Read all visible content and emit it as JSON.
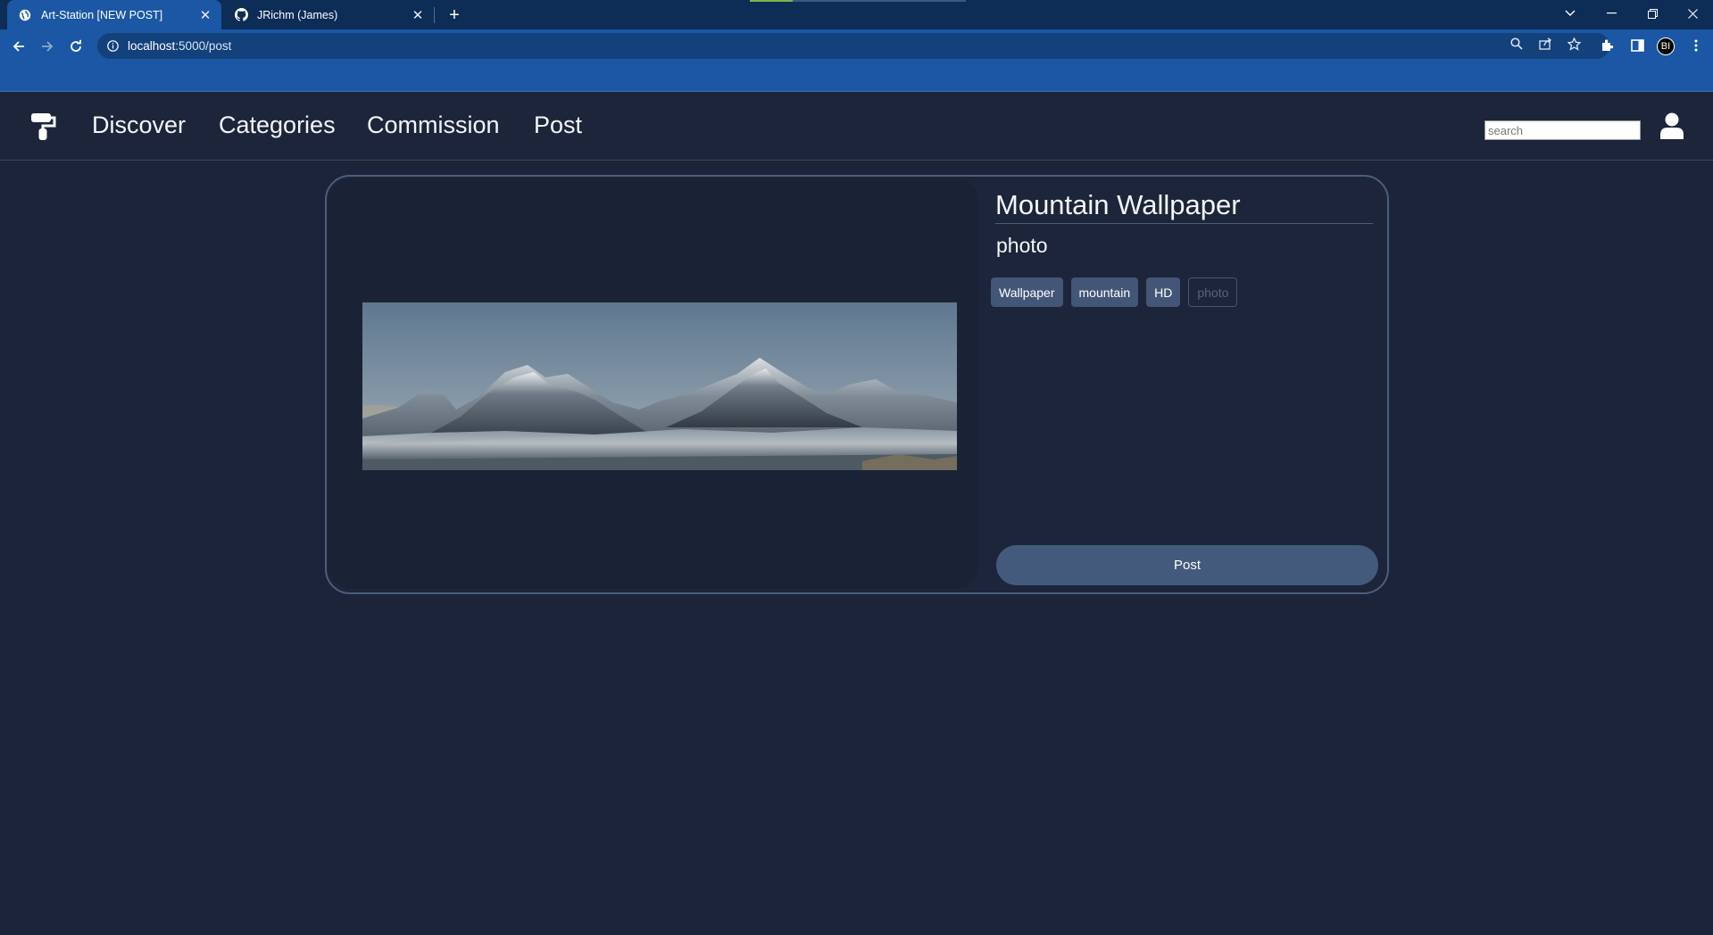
{
  "browser": {
    "tabs": [
      {
        "title": "Art-Station [NEW POST]",
        "active": true,
        "icon": "globe-icon"
      },
      {
        "title": "JRichm (James)",
        "active": false,
        "icon": "github-icon"
      }
    ],
    "new_tab_label": "+",
    "url_host": "localhost",
    "url_path": ":5000/post",
    "profile_initials": "BI"
  },
  "nav": {
    "links": [
      "Discover",
      "Categories",
      "Commission",
      "Post"
    ],
    "search_placeholder": "search"
  },
  "post": {
    "title": "Mountain Wallpaper",
    "category": "photo",
    "tags": [
      "Wallpaper",
      "mountain",
      "HD"
    ],
    "tag_input_placeholder": "photo",
    "submit_label": "Post",
    "image_subject": "snowy mountain range panorama"
  },
  "colors": {
    "page_bg": "#1b2438",
    "tab_strip": "#0d2c56",
    "toolbar": "#1b57a4",
    "accent_button": "#435a7c",
    "tag_bg": "#435677",
    "card_border": "#4a5e7e"
  }
}
